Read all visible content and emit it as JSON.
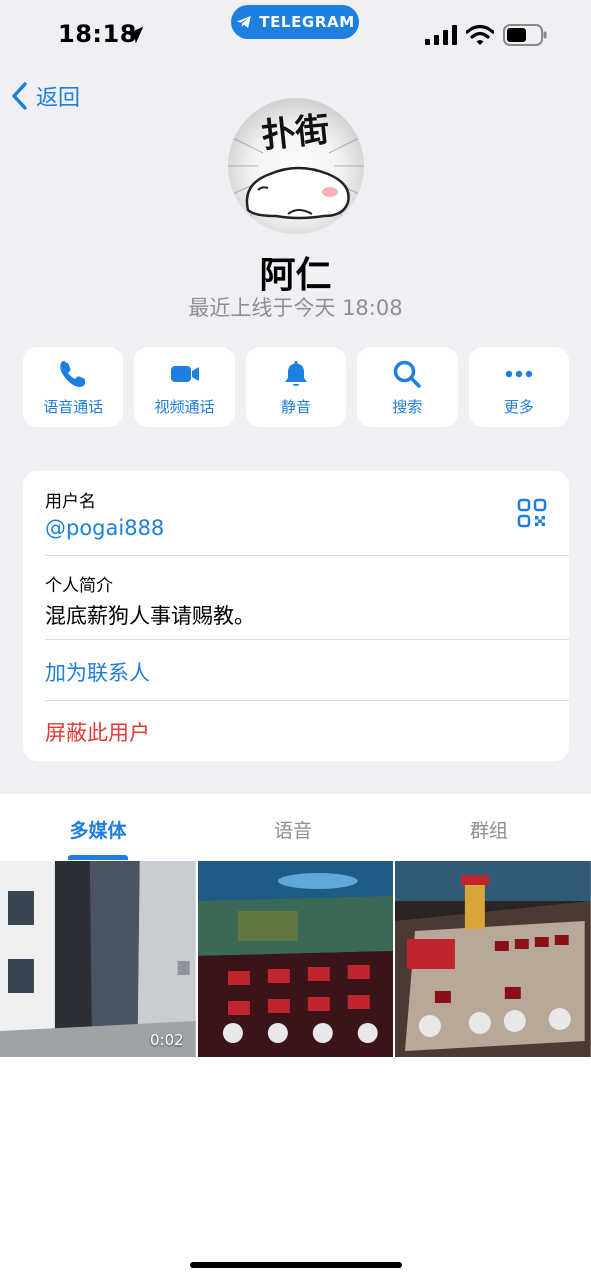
{
  "status_bar": {
    "time": "18:18",
    "app_pill": "TELEGRAM"
  },
  "nav": {
    "back_label": "返回"
  },
  "profile": {
    "name": "阿仁",
    "last_seen": "最近上线于今天 18:08",
    "avatar_text": "扑街"
  },
  "actions": [
    {
      "label": "语音通话",
      "icon": "phone-icon"
    },
    {
      "label": "视频通话",
      "icon": "video-icon"
    },
    {
      "label": "静音",
      "icon": "bell-icon"
    },
    {
      "label": "搜索",
      "icon": "search-icon"
    },
    {
      "label": "更多",
      "icon": "more-icon"
    }
  ],
  "info": {
    "username_label": "用户名",
    "username_value": "@pogai888",
    "bio_label": "个人简介",
    "bio_value": "混底薪狗人事请赐教。",
    "add_contact": "加为联系人",
    "block_user": "屏蔽此用户"
  },
  "tabs": [
    {
      "label": "多媒体",
      "active": true
    },
    {
      "label": "语音",
      "active": false
    },
    {
      "label": "群组",
      "active": false
    }
  ],
  "media": [
    {
      "type": "video",
      "duration": "0:02"
    },
    {
      "type": "photo"
    },
    {
      "type": "photo"
    }
  ],
  "colors": {
    "accent": "#1d7fe0",
    "danger": "#e53935",
    "secondary_text": "#8e8e93",
    "background": "#efeff4"
  }
}
